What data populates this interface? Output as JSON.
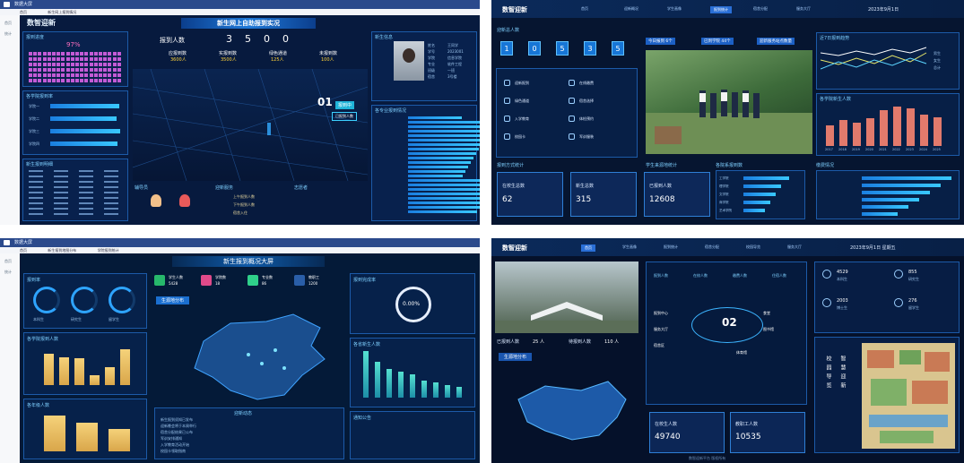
{
  "q1": {
    "app_title": "数据大屏",
    "tabs": [
      "首页",
      "新生网上报到情况"
    ],
    "side": [
      "首页",
      "统计"
    ],
    "logo": "数智迎新",
    "main_title": "新生网上自助报到实况",
    "left_title": "报到进度",
    "progress_pct": "97%",
    "progress_value": 0.97,
    "mid_title": "报到人数",
    "digits": [
      "3",
      "5",
      "0",
      "0"
    ],
    "stats": [
      {
        "label": "应报到数",
        "value": "3600人"
      },
      {
        "label": "实报到数",
        "value": "3500人"
      },
      {
        "label": "绿色通道",
        "value": "125人"
      },
      {
        "label": "未报到数",
        "value": "100人"
      }
    ],
    "bars_title": "各学院报到率",
    "bars": [
      {
        "label": "学院一",
        "value": 0.96
      },
      {
        "label": "学院二",
        "value": 0.92
      },
      {
        "label": "学院三",
        "value": 0.98
      },
      {
        "label": "学院四",
        "value": 0.94
      }
    ],
    "table_title": "新生报到明细",
    "map_badge": "01",
    "map_tag": "报到中",
    "map_tag2": "已报到人数",
    "profile_title": "新生信息",
    "profile_fields": [
      "姓名",
      "学号",
      "学院",
      "专业",
      "班级",
      "宿舍"
    ],
    "profile_values": [
      "王同学",
      "2023001",
      "信息学院",
      "软件工程",
      "一班",
      "3号楼"
    ],
    "list_title": "各专业报到情况",
    "bottom_titles": [
      "辅导员",
      "迎新服务",
      "志愿者"
    ],
    "bottom_rows": [
      "上午报到人数",
      "下午报到人数",
      "宿舍入住"
    ]
  },
  "q2": {
    "logo": "数智迎新",
    "nav": [
      "首页",
      "迎新概况",
      "学生画像",
      "报到统计",
      "宿舍分配",
      "服务大厅"
    ],
    "date": "2023年9月1日",
    "counter_title": "迎新总人数",
    "digits": [
      "1",
      "0",
      "5",
      "3",
      "5"
    ],
    "chips": [
      "今日报到 6个",
      "已到学院 44个",
      "迎新服务站点数量"
    ],
    "services": [
      "迎新报到",
      "在线缴费",
      "绿色通道",
      "宿舍选择",
      "入学教育",
      "体检预约",
      "校园卡",
      "军训服装"
    ],
    "line_title": "近7日报到趋势",
    "legend": [
      "男生",
      "女生",
      "总计"
    ],
    "bar_title": "各学院新生人数",
    "bar_categories": [
      "2017",
      "2018",
      "2019",
      "2020",
      "2021",
      "2022",
      "2023",
      "2024",
      "2025"
    ],
    "bar_values": [
      30,
      38,
      34,
      40,
      52,
      58,
      55,
      46,
      42
    ],
    "box_titles": [
      "报到方式统计",
      "学生来源地统计",
      "各院系报到数",
      "缴费情况"
    ],
    "boxes": [
      {
        "label": "在校生总数",
        "value": "62"
      },
      {
        "label": "新生总数",
        "value": "315"
      },
      {
        "label": "已报到人数",
        "value": "12608"
      }
    ],
    "hb_labels": [
      "工学院",
      "理学院",
      "文学院",
      "商学院",
      "艺术学院"
    ],
    "hb_values": [
      0.85,
      0.7,
      0.6,
      0.5,
      0.4
    ]
  },
  "q3": {
    "app_title": "数据大屏",
    "tabs": [
      "首页",
      "新生报到地图分布",
      "学院报到统计"
    ],
    "side": [
      "首页",
      "统计"
    ],
    "main_title": "新生报到概况大屏",
    "gauges_title": "报到率",
    "gauge_labels": [
      "本科生",
      "研究生",
      "留学生"
    ],
    "gauge_values": [
      0.92,
      0.88,
      0.75
    ],
    "icons": [
      {
        "label": "学生人数",
        "value": "5428"
      },
      {
        "label": "学院数",
        "value": "18"
      },
      {
        "label": "专业数",
        "value": "86"
      },
      {
        "label": "教职工",
        "value": "1200"
      }
    ],
    "map_label": "生源地分布",
    "bar1_title": "各学院报到人数",
    "bar1_values": [
      62,
      55,
      52,
      20,
      35,
      70
    ],
    "bar2_title": "各年级人数",
    "bar2_values": [
      60,
      48,
      38
    ],
    "ring_title": "报到完成率",
    "ring_text": "0.00%",
    "cbar_title": "各省新生人数",
    "cbar_values": [
      80,
      62,
      50,
      45,
      40,
      30,
      26,
      22,
      18
    ],
    "news_title": "迎新动态",
    "news_rows": [
      "新生报到须知已发布",
      "迎新晚会将于本周举行",
      "宿舍分配结果已公布",
      "军训安排通知",
      "入学教育活动开始",
      "校园卡领取指南"
    ],
    "notice_title": "通知公告"
  },
  "q4": {
    "logo": "数智迎新",
    "nav": [
      "首页",
      "学生画像",
      "报到统计",
      "宿舍分配",
      "校园导览",
      "服务大厅"
    ],
    "date": "2023年9月1日 星期五",
    "strip": [
      {
        "label": "已报到人数",
        "value": "25 人"
      },
      {
        "label": "待报到人数",
        "value": "110 人"
      }
    ],
    "map_title": "生源地分布",
    "top_labels": [
      "报到人数",
      "在校人数",
      "缴费人数",
      "住宿人数"
    ],
    "center_badge": "02",
    "orbit_labels": [
      "报到中心",
      "服务大厅",
      "宿舍区",
      "食堂",
      "图书馆",
      "体育馆"
    ],
    "boxes": [
      {
        "label": "在校生人数",
        "value": "49740"
      },
      {
        "label": "教职工人数",
        "value": "10535"
      }
    ],
    "right_stats": [
      {
        "label": "本科生",
        "value": "4529"
      },
      {
        "label": "研究生",
        "value": "855"
      },
      {
        "label": "博士生",
        "value": "2003"
      },
      {
        "label": "留学生",
        "value": "276"
      }
    ],
    "vertical_text": [
      "校园导览",
      "智慧迎新"
    ],
    "footer": "数智迎新平台 版权所有"
  }
}
